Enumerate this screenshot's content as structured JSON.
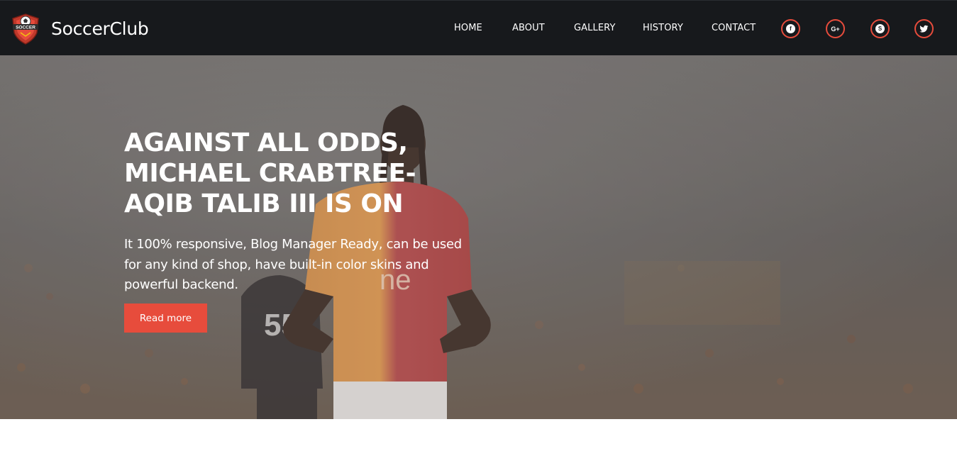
{
  "brand": {
    "logo_text": "SOCCER",
    "name": "SoccerClub"
  },
  "nav": {
    "items": [
      {
        "label": "HOME"
      },
      {
        "label": "ABOUT"
      },
      {
        "label": "GALLERY"
      },
      {
        "label": "HISTORY"
      },
      {
        "label": "CONTACT"
      }
    ],
    "social": [
      {
        "icon": "facebook-icon",
        "glyph": "f"
      },
      {
        "icon": "google-plus-icon",
        "glyph": "G+"
      },
      {
        "icon": "skype-icon",
        "glyph": "S"
      },
      {
        "icon": "twitter-icon",
        "glyph": "t"
      }
    ]
  },
  "hero": {
    "title": "AGAINST ALL ODDS, MICHAEL CRABTREE- AQIB TALIB III IS ON",
    "text": "It 100% responsive, Blog Manager Ready, can be used for any kind of shop, have built-in color skins and powerful backend.",
    "button_label": "Read more",
    "jersey_text": "ne",
    "jersey_number": "55"
  },
  "colors": {
    "navbar_bg": "#17191c",
    "accent": "#e74c3c",
    "hero_overlay": "#7a7775"
  }
}
